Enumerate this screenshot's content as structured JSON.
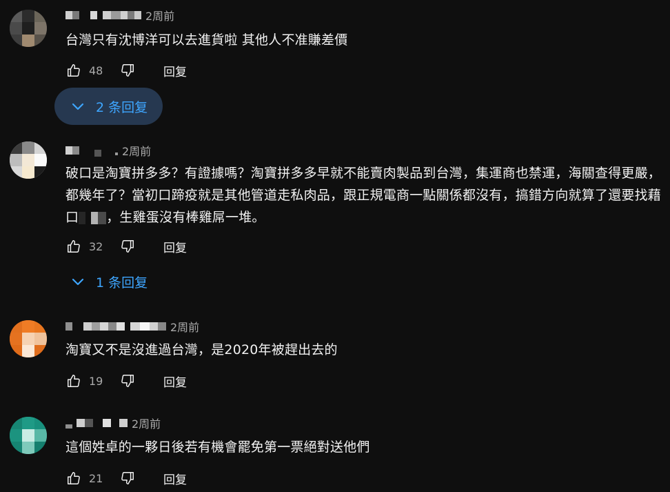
{
  "comments": [
    {
      "time": "2周前",
      "text": "台灣只有沈博洋可以去進貨啦 其他人不准賺差價",
      "likes": "48",
      "reply_label": "回复",
      "replies_label": "2 条回复"
    },
    {
      "time": "2周前",
      "text_part1": "破口是淘寶拼多多？有證據嗎？淘寶拼多多早就不能賣肉製品到台灣，集運商也禁運，海關查得更嚴，都幾年了？當初口蹄疫就是其他管道走私肉品，跟正規電商一點關係都沒有，搞錯方向就算了還要找藉口",
      "text_part2": "，生雞蛋沒有棒雞屌一堆。",
      "likes": "32",
      "reply_label": "回复",
      "replies_label": "1 条回复"
    },
    {
      "time": "2周前",
      "text": "淘寶又不是沒進過台灣，是2020年被趕出去的",
      "likes": "19",
      "reply_label": "回复"
    },
    {
      "time": "2周前",
      "text": "這個姓卓的一夥日後若有機會罷免第一票絕對送他們",
      "likes": "21",
      "reply_label": "回复"
    }
  ],
  "icons": {
    "like": "thumb-up-icon",
    "dislike": "thumb-down-icon",
    "expand": "chevron-down-icon"
  },
  "colors": {
    "background": "#0f0f0f",
    "link_blue": "#3ea6ff",
    "replies_bg": "#263850",
    "secondary_text": "#aaaaaa"
  }
}
